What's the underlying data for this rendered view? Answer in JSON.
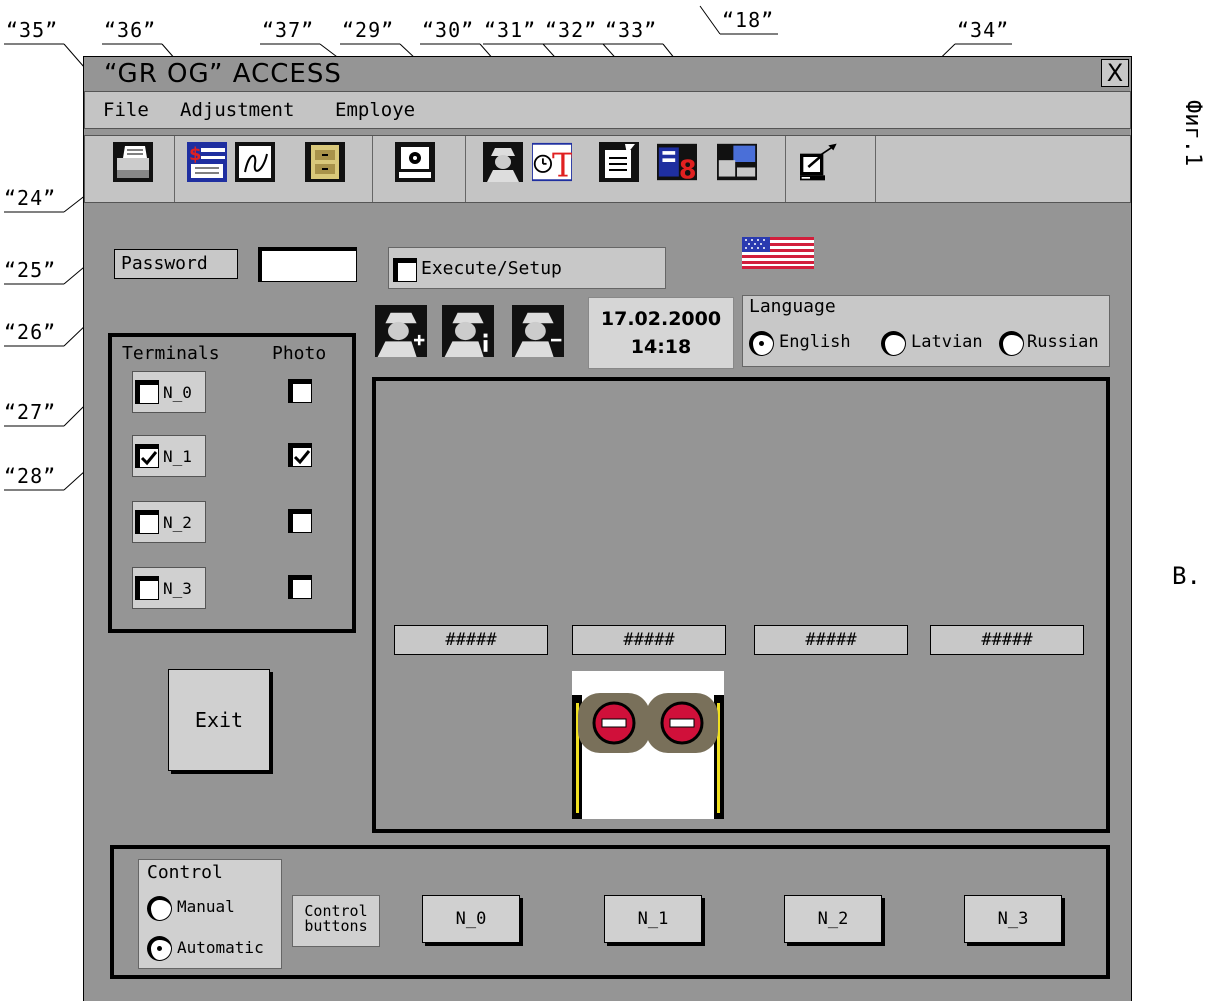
{
  "callouts": {
    "c35": "“35”",
    "c36": "“36”",
    "c37": "“37”",
    "c29": "“29”",
    "c30": "“30”",
    "c31": "“31”",
    "c32": "“32”",
    "c33": "“33”",
    "c18": "“18”",
    "c34": "“34”",
    "c24": "“24”",
    "c25": "“25”",
    "c26": "“26”",
    "c27": "“27”",
    "c28": "“28”"
  },
  "side_text": {
    "fig": "Фиг.1",
    "letter": "B."
  },
  "window": {
    "title": "“GR OG” ACCESS",
    "close": "X"
  },
  "menu": {
    "file": "File",
    "adjustment": "Adjustment",
    "employe": "Employe"
  },
  "toolbar": {
    "icons": [
      "printer-icon",
      "price-list-icon",
      "signature-icon",
      "file-cabinet-icon",
      "disk-icon",
      "agent-icon",
      "timesheet-icon",
      "document-edit-icon",
      "transfer-icon",
      "computer-network-icon",
      "export-icon"
    ]
  },
  "login": {
    "password_label": "Password",
    "password_value": "",
    "execute_label": "Execute/Setup"
  },
  "datetime": {
    "date": "17.02.2000",
    "time": "14:18"
  },
  "language": {
    "title": "Language",
    "options": [
      "English",
      "Latvian",
      "Russian"
    ],
    "selected": "English"
  },
  "terminals": {
    "header_terminals": "Terminals",
    "header_photo": "Photo",
    "rows": [
      {
        "label": "N_0",
        "terminal_checked": false,
        "photo_checked": false
      },
      {
        "label": "N_1",
        "terminal_checked": true,
        "photo_checked": true
      },
      {
        "label": "N_2",
        "terminal_checked": false,
        "photo_checked": false
      },
      {
        "label": "N_3",
        "terminal_checked": false,
        "photo_checked": false
      }
    ]
  },
  "display": {
    "fields": [
      "#####",
      "#####",
      "#####",
      "#####"
    ]
  },
  "exit_label": "Exit",
  "control": {
    "title": "Control",
    "manual": "Manual",
    "automatic": "Automatic",
    "selected": "Automatic",
    "buttons_label_1": "Control",
    "buttons_label_2": "buttons",
    "buttons": [
      "N_0",
      "N_1",
      "N_2",
      "N_3"
    ]
  },
  "colors": {
    "window_bg": "#959595",
    "panel_bg": "#c8c8c8",
    "stop_sign": "#d0103a",
    "flag_red": "#d21f3c",
    "flag_blue": "#2a3ab0"
  }
}
